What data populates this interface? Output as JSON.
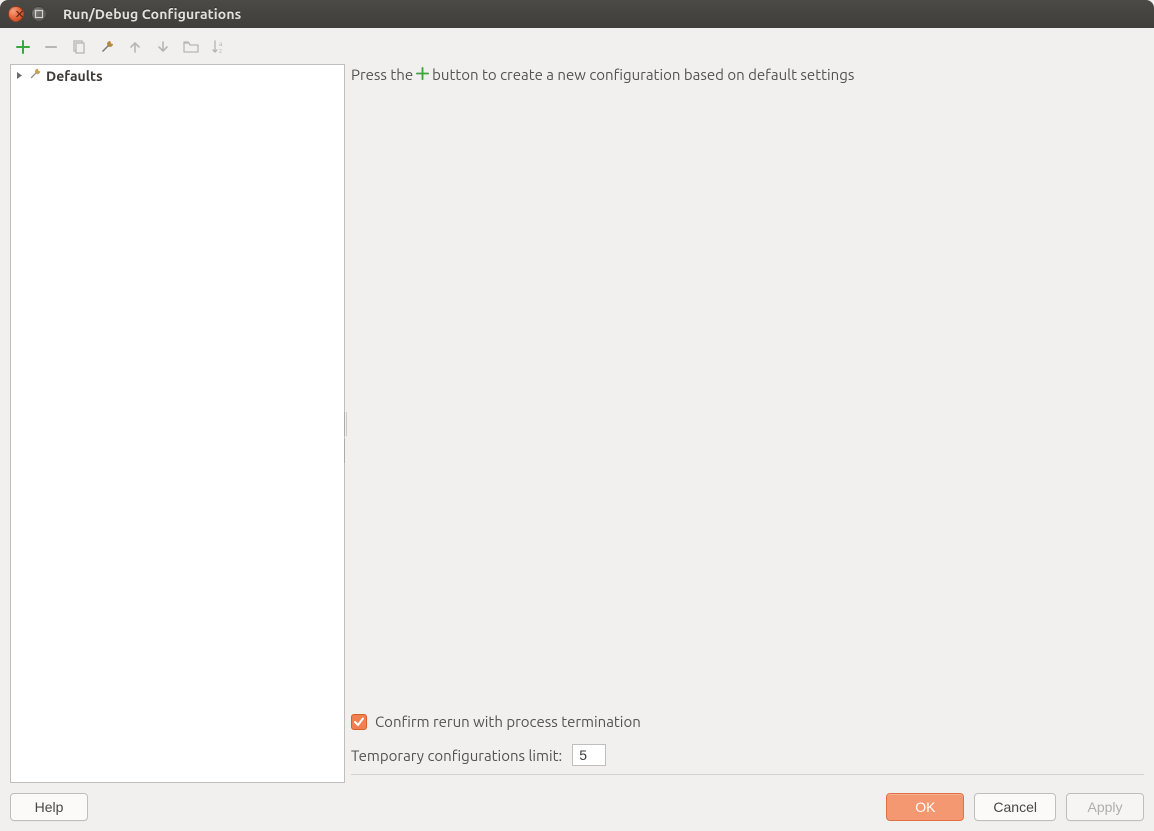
{
  "window": {
    "title": "Run/Debug Configurations"
  },
  "toolbar": {
    "icons": {
      "add": "add-icon",
      "remove": "remove-icon",
      "copy": "copy-icon",
      "edit_defaults": "wrench-icon",
      "up": "arrow-up-icon",
      "down": "arrow-down-icon",
      "folder": "folder-icon",
      "sort": "sort-az-icon"
    }
  },
  "tree": {
    "items": [
      {
        "label": "Defaults",
        "expandable": true
      }
    ]
  },
  "detail": {
    "hint_pre": "Press the",
    "hint_post": " button to create a new configuration based on default settings",
    "confirm_rerun_label": "Confirm rerun with process termination",
    "confirm_rerun_checked": true,
    "limit_label": "Temporary configurations limit:",
    "limit_value": "5"
  },
  "buttons": {
    "help": "Help",
    "ok": "OK",
    "cancel": "Cancel",
    "apply": "Apply"
  },
  "colors": {
    "accent": "#f08050",
    "accent_border": "#d55f28"
  }
}
